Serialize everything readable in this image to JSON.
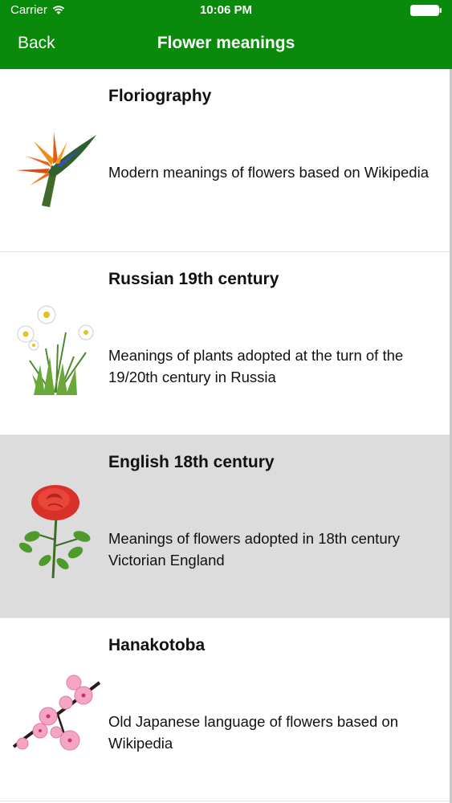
{
  "status_bar": {
    "carrier": "Carrier",
    "time": "10:06 PM"
  },
  "nav": {
    "back_label": "Back",
    "title": "Flower meanings"
  },
  "colors": {
    "header": "#0a8a0a",
    "selected_row": "#dcdcdc"
  },
  "items": [
    {
      "title": "Floriography",
      "description": "Modern meanings of flowers based on Wikipedia",
      "icon": "bird-of-paradise-icon",
      "selected": false
    },
    {
      "title": "Russian 19th century",
      "description": "Meanings of plants adopted at the turn of the 19/20th century in Russia",
      "icon": "chamomile-icon",
      "selected": false
    },
    {
      "title": "English 18th century",
      "description": "Meanings of flowers adopted in 18th century Victorian England",
      "icon": "rose-icon",
      "selected": true
    },
    {
      "title": "Hanakotoba",
      "description": "Old Japanese language of flowers based on Wikipedia",
      "icon": "cherry-blossom-icon",
      "selected": false
    }
  ]
}
